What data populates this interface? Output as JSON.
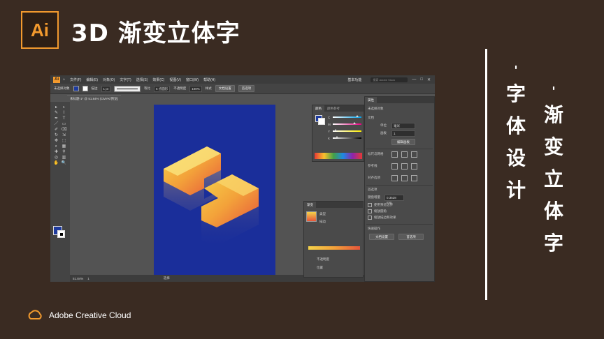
{
  "slide": {
    "logo_text": "Ai",
    "title": "3D 渐变立体字",
    "vertical_left": [
      "字",
      "体",
      "设",
      "计"
    ],
    "vertical_right": [
      "渐",
      "变",
      "立",
      "体",
      "字"
    ],
    "quote_mark": "'",
    "footer": "Adobe Creative Cloud",
    "colors": {
      "background": "#3a2b22",
      "accent": "#f29a2e",
      "artboard": "#1a2e9a"
    }
  },
  "app": {
    "logo": "Ai",
    "menu": [
      "文件(F)",
      "编辑(E)",
      "对象(O)",
      "文字(T)",
      "选择(S)",
      "效果(C)",
      "视图(V)",
      "窗口(W)",
      "帮助(H)"
    ],
    "workspace": "基本功能",
    "search_placeholder": "搜索 Adobe Stock",
    "window_buttons": [
      "—",
      "□",
      "✕"
    ],
    "control": {
      "no_selection": "未选择对象",
      "stroke_label": "描边",
      "stroke_value": "1 pt",
      "uniform": "等比",
      "brush": "5 点圆形",
      "opacity_label": "不透明度",
      "opacity_value": "100%",
      "style_label": "样式",
      "doc_setup": "文档设置",
      "preferences": "首选项"
    },
    "doc_tab": "未标题-1* @ 51.84% (CMYK/预览)",
    "status": {
      "zoom": "51.84%",
      "page": "1",
      "mode": "选择"
    },
    "color_panel": {
      "tabs": [
        "颜色",
        "颜色参考"
      ],
      "channels": [
        "C",
        "M",
        "Y",
        "K"
      ],
      "fill": "#1e3b9e"
    },
    "gradient_panel": {
      "tab": "渐变",
      "type_label": "类型",
      "stroke_label": "描边",
      "opacity_label": "不透明度",
      "location_label": "位置",
      "colors": [
        "#f5d24a",
        "#f3a23a",
        "#e6553a"
      ]
    },
    "properties_panel": {
      "tab": "属性",
      "no_selection": "未选择对象",
      "document": "文档",
      "units_label": "单位",
      "units_value": "毫米",
      "artboard_label": "画板",
      "artboard_value": "1",
      "edit_artboard": "编辑画板",
      "ruler_grid": "标尺与网格",
      "guides": "参考线",
      "align": "对齐选项",
      "preferences_header": "首选项",
      "keyboard_increment_label": "键盘增量",
      "keyboard_increment_value": "0.3528 mm",
      "checkboxes": [
        "使用预览边界",
        "缩放圆角",
        "缩放描边和效果"
      ],
      "quick_actions": "快速操作",
      "doc_setup": "文档设置",
      "preferences": "首选项"
    }
  }
}
